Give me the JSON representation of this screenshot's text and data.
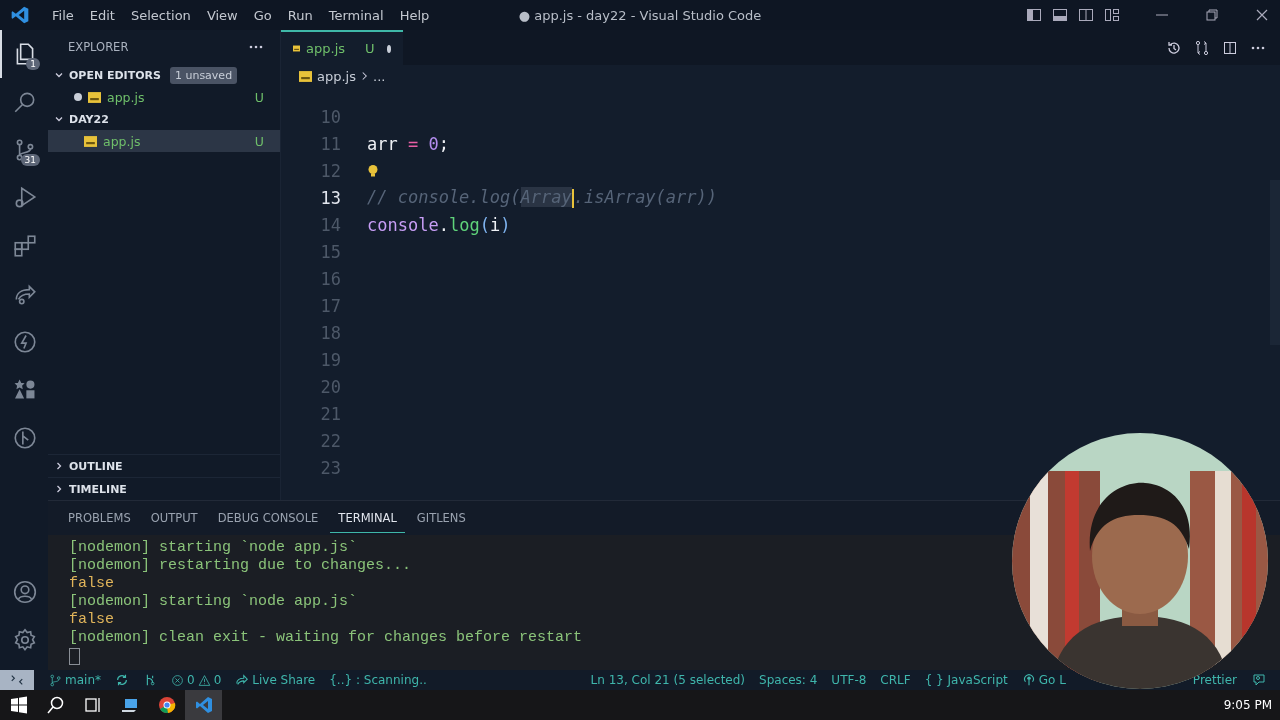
{
  "window": {
    "title": "● app.js - day22 - Visual Studio Code"
  },
  "menu": [
    "File",
    "Edit",
    "Selection",
    "View",
    "Go",
    "Run",
    "Terminal",
    "Help"
  ],
  "activity_bar": [
    {
      "kind": "files",
      "selected": true,
      "badge": "1"
    },
    {
      "kind": "search",
      "selected": false
    },
    {
      "kind": "source-control",
      "selected": false,
      "badge": "31"
    },
    {
      "kind": "run-debug",
      "selected": false
    },
    {
      "kind": "extensions",
      "selected": false
    },
    {
      "kind": "live-share",
      "selected": false
    },
    {
      "kind": "lightning",
      "selected": false
    },
    {
      "kind": "shapes",
      "selected": false
    },
    {
      "kind": "gitlens",
      "selected": false
    }
  ],
  "activity_bottom": [
    {
      "kind": "account"
    },
    {
      "kind": "settings"
    }
  ],
  "sidebar": {
    "title": "EXPLORER",
    "sections": [
      {
        "label": "OPEN EDITORS",
        "expanded": true,
        "badge": "1 unsaved",
        "items": [
          {
            "name": "app.js",
            "status": "U",
            "modified": true,
            "selected": false
          }
        ]
      },
      {
        "label": "DAY22",
        "expanded": true,
        "items": [
          {
            "name": "app.js",
            "status": "U",
            "modified": false,
            "selected": true
          }
        ]
      }
    ],
    "bottom_sections": [
      {
        "label": "OUTLINE",
        "expanded": false
      },
      {
        "label": "TIMELINE",
        "expanded": false
      }
    ]
  },
  "editor": {
    "tabs": [
      {
        "name": "app.js",
        "status": "U",
        "modified": true,
        "selected": true
      }
    ],
    "breadcrumb": {
      "file": "app.js",
      "rest": "..."
    },
    "lines": [
      {
        "number": "10"
      },
      {
        "number": "11",
        "tokens": [
          {
            "kind": "var",
            "text": "arr"
          },
          {
            "kind": "op",
            "text": " = "
          },
          {
            "kind": "num",
            "text": "0"
          },
          {
            "kind": "var",
            "text": ";"
          }
        ]
      },
      {
        "number": "12",
        "lightbulb": true
      },
      {
        "number": "13",
        "current": true,
        "tokens": [
          {
            "kind": "comment",
            "text": "// console.log("
          },
          {
            "kind": "comment",
            "text": "Array",
            "selected": true,
            "cursor_after": true
          },
          {
            "kind": "comment",
            "text": ".isArray(arr))"
          }
        ]
      },
      {
        "number": "14",
        "tokens": [
          {
            "kind": "obj",
            "text": "console"
          },
          {
            "kind": "var",
            "text": "."
          },
          {
            "kind": "fn",
            "text": "log"
          },
          {
            "kind": "paren",
            "text": "("
          },
          {
            "kind": "var",
            "text": "i"
          },
          {
            "kind": "paren",
            "text": ")"
          }
        ]
      },
      {
        "number": "15"
      },
      {
        "number": "16"
      },
      {
        "number": "17"
      },
      {
        "number": "18"
      },
      {
        "number": "19"
      },
      {
        "number": "20"
      },
      {
        "number": "21"
      },
      {
        "number": "22"
      },
      {
        "number": "23"
      }
    ]
  },
  "panel": {
    "tabs": [
      {
        "label": "PROBLEMS",
        "selected": false
      },
      {
        "label": "OUTPUT",
        "selected": false
      },
      {
        "label": "DEBUG CONSOLE",
        "selected": false
      },
      {
        "label": "TERMINAL",
        "selected": true
      },
      {
        "label": "GITLENS",
        "selected": false
      }
    ],
    "terminal": [
      {
        "kind": "log",
        "text": "[nodemon] starting `node app.js`"
      },
      {
        "kind": "log",
        "text": "[nodemon] restarting due to changes..."
      },
      {
        "kind": "output",
        "text": "false"
      },
      {
        "kind": "log",
        "text": "[nodemon] starting `node app.js`"
      },
      {
        "kind": "output",
        "text": "false"
      },
      {
        "kind": "log",
        "text": "[nodemon] clean exit - waiting for changes before restart"
      }
    ]
  },
  "webcam": {
    "kind": "picture"
  },
  "status_bar": {
    "left": [
      {
        "kind": "branch",
        "text": "main*"
      },
      {
        "kind": "sync"
      },
      {
        "kind": "git-graph"
      },
      {
        "kind": "problems",
        "text": "0",
        "warnings": "0"
      },
      {
        "kind": "live-share",
        "text": "Live Share"
      },
      {
        "kind": "plain",
        "text": "{..} : Scanning.."
      }
    ],
    "right": [
      {
        "kind": "plain",
        "text": "Ln 13, Col 21 (5 selected)"
      },
      {
        "kind": "plain",
        "text": "Spaces: 4"
      },
      {
        "kind": "plain",
        "text": "UTF-8"
      },
      {
        "kind": "plain",
        "text": "CRLF"
      },
      {
        "kind": "plain",
        "text": "{ }  JavaScript"
      },
      {
        "kind": "golive",
        "text": "Go L"
      },
      {
        "kind": "plain",
        "text": "Prettier"
      },
      {
        "kind": "feedback"
      }
    ]
  },
  "taskbar": {
    "apps": [
      {
        "kind": "start"
      },
      {
        "kind": "search"
      },
      {
        "kind": "task-view"
      },
      {
        "kind": "laptop"
      },
      {
        "kind": "chrome"
      },
      {
        "kind": "vscode",
        "selected": true
      }
    ],
    "time": "9:05 PM"
  }
}
